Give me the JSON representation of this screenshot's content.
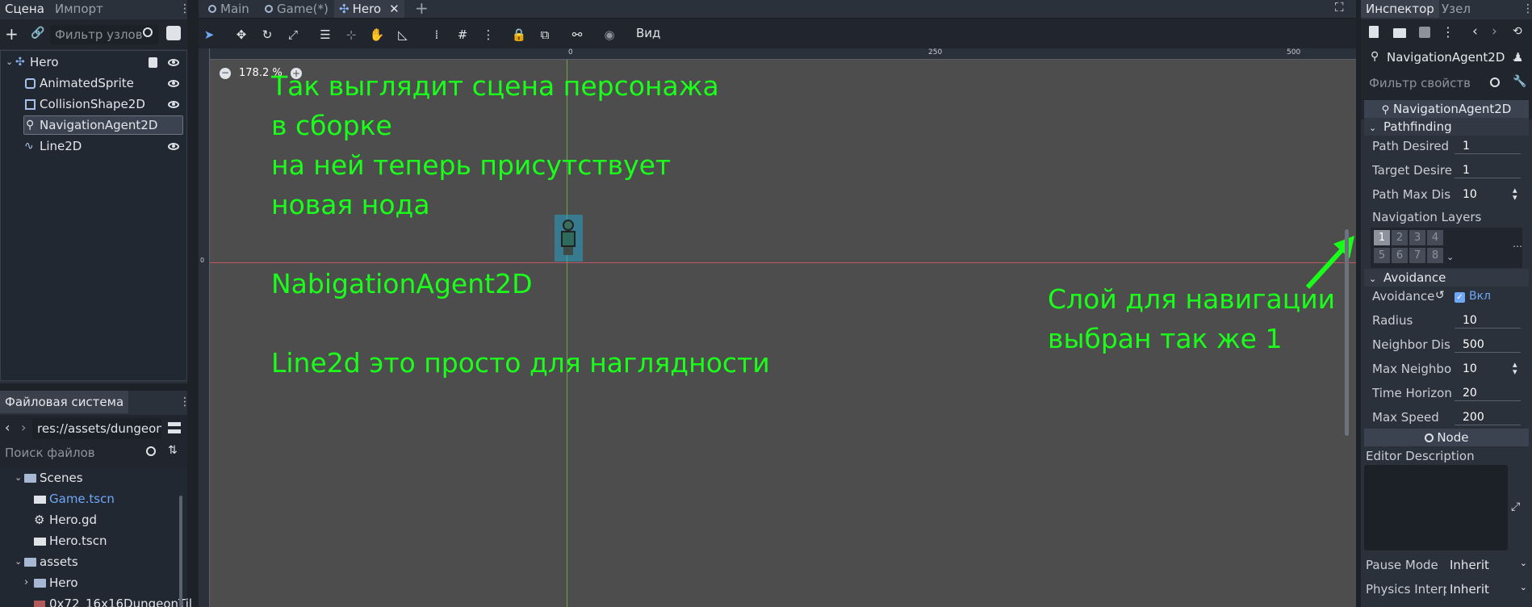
{
  "scene_dock": {
    "tabs": [
      "Сцена",
      "Импорт"
    ],
    "filter_placeholder": "Фильтр узлов",
    "tree": [
      {
        "label": "Hero",
        "icon": "hero-node-icon"
      },
      {
        "label": "AnimatedSprite",
        "icon": "sprite-icon"
      },
      {
        "label": "CollisionShape2D",
        "icon": "collision-shape-icon"
      },
      {
        "label": "NavigationAgent2D",
        "icon": "navigation-pin-icon"
      },
      {
        "label": "Line2D",
        "icon": "line2d-icon"
      }
    ]
  },
  "filesystem": {
    "title": "Файловая система",
    "path": "res://assets/dungeon_",
    "search_placeholder": "Поиск файлов",
    "items": [
      {
        "label": "Scenes",
        "type": "folder"
      },
      {
        "label": "Game.tscn",
        "type": "scene"
      },
      {
        "label": "Hero.gd",
        "type": "script"
      },
      {
        "label": "Hero.tscn",
        "type": "scene"
      },
      {
        "label": "assets",
        "type": "folder"
      },
      {
        "label": "Hero",
        "type": "folder"
      },
      {
        "label": "0x72_16x16DungeonTil",
        "type": "file"
      }
    ]
  },
  "editor_tabs": [
    "Main",
    "Game(*)",
    "Hero"
  ],
  "toolbar": {
    "view_label": "Вид"
  },
  "viewport": {
    "zoom": "178.2 %",
    "ruler_marks": [
      "0",
      "250",
      "500"
    ],
    "annotation_left": [
      "Так выглядит сцена персонажа",
      "в сборке",
      "на ней теперь присутствует",
      "новая нода",
      "",
      "NabigationAgent2D",
      "",
      "Line2d это просто для наглядности"
    ],
    "annotation_right": [
      "Слой для навигации",
      "выбран так же 1"
    ]
  },
  "inspector": {
    "tabs": [
      "Инспектор",
      "Узел"
    ],
    "object_name": "NavigationAgent2D",
    "filter_placeholder": "Фильтр свойств",
    "class_header": "NavigationAgent2D",
    "pathfinding_header": "Pathfinding",
    "props_path": [
      {
        "label": "Path Desired",
        "value": "1"
      },
      {
        "label": "Target Desire",
        "value": "1"
      },
      {
        "label": "Path Max Dis",
        "value": "10"
      }
    ],
    "nav_layers_label": "Navigation Layers",
    "layers": [
      "1",
      "2",
      "3",
      "4",
      "5",
      "6",
      "7",
      "8"
    ],
    "avoidance_header": "Avoidance",
    "avoidance_label": "Avoidance",
    "avoidance_value": "Вкл",
    "props_avoid": [
      {
        "label": "Radius",
        "value": "10"
      },
      {
        "label": "Neighbor Dis",
        "value": "500"
      },
      {
        "label": "Max Neighbo",
        "value": "10"
      },
      {
        "label": "Time Horizon",
        "value": "20"
      },
      {
        "label": "Max Speed",
        "value": "200"
      }
    ],
    "node_header": "Node",
    "editor_description_label": "Editor Description",
    "pause_mode_label": "Pause Mode",
    "pause_mode_value": "Inherit",
    "physics_interp_label": "Physics Interp",
    "physics_interp_value": "Inherit"
  },
  "colors": {
    "annotation": "#1aff1a",
    "accent": "#6fa8f5",
    "background": "#1d2229",
    "panel": "#2b313b"
  }
}
